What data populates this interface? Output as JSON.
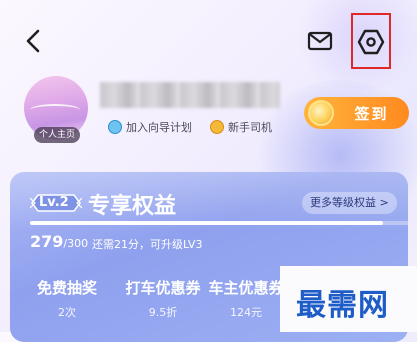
{
  "header": {
    "back_icon": "chevron-left-icon",
    "mail_icon": "mail-icon",
    "settings_icon": "hexagon-settings-icon",
    "highlight_color": "#e02828"
  },
  "profile": {
    "avatar_tag": "个人主页",
    "badges": [
      {
        "label": "加入向导计划",
        "icon": "guide-plan-icon"
      },
      {
        "label": "新手司机",
        "icon": "rookie-driver-icon"
      }
    ],
    "checkin_label": "签到",
    "checkin_color": "#ff9a2a"
  },
  "level_card": {
    "level": "Lv.2",
    "title": "专享权益",
    "more_link": "更多等级权益 >",
    "points_current": "279",
    "points_max": "/300",
    "progress_ratio": 0.93,
    "upgrade_note": "还需21分，可升级LV3",
    "benefits": [
      {
        "title": "免费抽奖",
        "sub": "2次"
      },
      {
        "title": "打车优惠券",
        "sub": "9.5折"
      },
      {
        "title": "车主优惠券",
        "sub": "124元"
      }
    ]
  },
  "watermark": {
    "text": "最需网",
    "color": "#1e5cc8"
  }
}
